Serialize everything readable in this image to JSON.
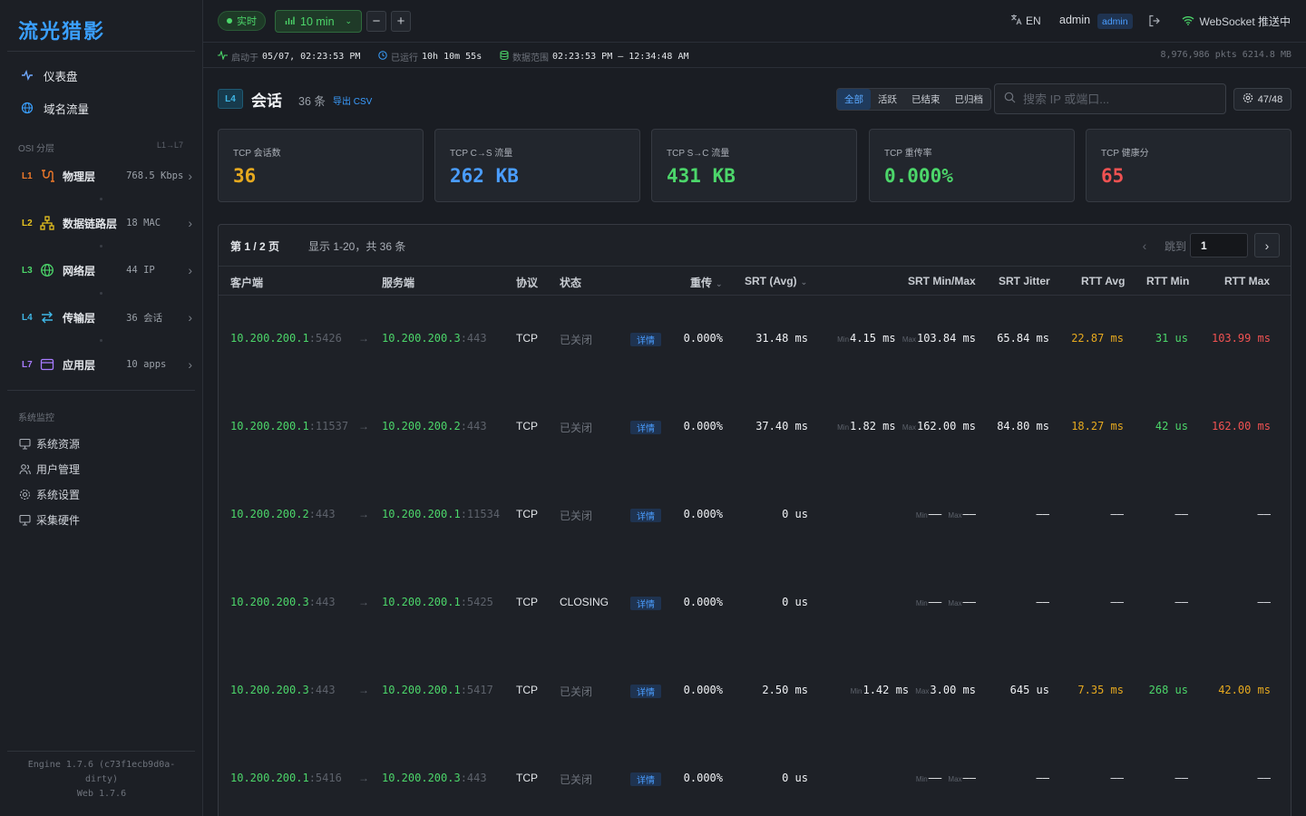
{
  "app": {
    "brand": "流光猎影",
    "nav": {
      "dashboard": "仪表盘",
      "dns": "域名流量"
    },
    "osi_title": "OSI 分层",
    "osi_range": "L1→L7",
    "layers": [
      {
        "code": "L1",
        "label": "物理层",
        "value": "768.5 Kbps",
        "color": "#f07a2a"
      },
      {
        "code": "L2",
        "label": "数据链路层",
        "value": "18 MAC",
        "color": "#e6c21f"
      },
      {
        "code": "L3",
        "label": "网络层",
        "value": "44 IP",
        "color": "#4cd66a"
      },
      {
        "code": "L4",
        "label": "传输层",
        "value": "36 会话",
        "color": "#3fb7e6"
      },
      {
        "code": "L7",
        "label": "应用层",
        "value": "10 apps",
        "color": "#a77bff"
      }
    ],
    "sys_title": "系统监控",
    "sys_items": [
      "系统资源",
      "用户管理",
      "系统设置",
      "采集硬件"
    ],
    "footer": {
      "engine": "Engine 1.7.6 (c73f1ecb9d0a-",
      "engine2": "dirty)",
      "web": "Web 1.7.6"
    }
  },
  "topbar": {
    "live": "实时",
    "range": "10 min",
    "minus": "−",
    "plus": "+",
    "lang": "EN",
    "user": "admin",
    "role": "admin",
    "ws": "WebSocket 推送中"
  },
  "info": {
    "start_k": "启动于",
    "start_v": "05/07, 02:23:53 PM",
    "uptime_k": "已运行",
    "uptime_v": "10h 10m 55s",
    "range_k": "数据范围",
    "range_v": "02:23:53 PM – 12:34:48 AM",
    "pkts": "8,976,986 pkts  6214.8 MB"
  },
  "section": {
    "badge": "L4",
    "title": "会话",
    "count": "36 条",
    "export": "导出 CSV",
    "filters": [
      "全部",
      "活跃",
      "已结束",
      "已归档"
    ],
    "search_placeholder": "搜索 IP 或端口...",
    "columns_btn": "47/48"
  },
  "kpis": [
    {
      "label": "TCP 会话数",
      "value": "36",
      "color": "#e6a91f"
    },
    {
      "label": "TCP C→S 流量",
      "value": "262 KB",
      "color": "#4a9dff"
    },
    {
      "label": "TCP S→C 流量",
      "value": "431 KB",
      "color": "#4cd66a"
    },
    {
      "label": "TCP 重传率",
      "value": "0.000%",
      "color": "#4cd66a"
    },
    {
      "label": "TCP 健康分",
      "value": "65",
      "color": "#f05252"
    }
  ],
  "table": {
    "page_label": "第 1 / 2 页",
    "summary": "显示 1-20，共 36 条",
    "jump_label": "跳到",
    "jump_value": "1",
    "headers": {
      "client": "客户端",
      "server": "服务端",
      "proto": "协议",
      "state": "状态",
      "retrans": "重传",
      "srt_avg": "SRT (Avg)",
      "srt_mm": "SRT Min/Max",
      "srt_jitter": "SRT Jitter",
      "rtt_avg": "RTT Avg",
      "rtt_min": "RTT Min",
      "rtt_max": "RTT Max"
    },
    "detail_label": "详情",
    "min_tag": "Min",
    "max_tag": "Max",
    "rows": [
      {
        "cip": "10.200.200.1",
        "cport": ":5426",
        "sip": "10.200.200.3",
        "sport": ":443",
        "proto": "TCP",
        "state": "已关闭",
        "retrans": "0.000%",
        "srt_avg": "31.48 ms",
        "srt_min": "4.15 ms",
        "srt_max": "103.84 ms",
        "jitter": "65.84 ms",
        "rtt_avg": "22.87 ms",
        "rtt_min": "31 us",
        "rtt_max": "103.99 ms"
      },
      {
        "cip": "10.200.200.1",
        "cport": ":11537",
        "sip": "10.200.200.2",
        "sport": ":443",
        "proto": "TCP",
        "state": "已关闭",
        "retrans": "0.000%",
        "srt_avg": "37.40 ms",
        "srt_min": "1.82 ms",
        "srt_max": "162.00 ms",
        "jitter": "84.80 ms",
        "rtt_avg": "18.27 ms",
        "rtt_min": "42 us",
        "rtt_max": "162.00 ms"
      },
      {
        "cip": "10.200.200.2",
        "cport": ":443",
        "sip": "10.200.200.1",
        "sport": ":11534",
        "proto": "TCP",
        "state": "已关闭",
        "retrans": "0.000%",
        "srt_avg": "0 us",
        "srt_min": "——",
        "srt_max": "——",
        "jitter": "——",
        "rtt_avg": "——",
        "rtt_min": "——",
        "rtt_max": "——"
      },
      {
        "cip": "10.200.200.3",
        "cport": ":443",
        "sip": "10.200.200.1",
        "sport": ":5425",
        "proto": "TCP",
        "state": "CLOSING",
        "retrans": "0.000%",
        "srt_avg": "0 us",
        "srt_min": "——",
        "srt_max": "——",
        "jitter": "——",
        "rtt_avg": "——",
        "rtt_min": "——",
        "rtt_max": "——"
      },
      {
        "cip": "10.200.200.3",
        "cport": ":443",
        "sip": "10.200.200.1",
        "sport": ":5417",
        "proto": "TCP",
        "state": "已关闭",
        "retrans": "0.000%",
        "srt_avg": "2.50 ms",
        "srt_min": "1.42 ms",
        "srt_max": "3.00 ms",
        "jitter": "645 us",
        "rtt_avg": "7.35 ms",
        "rtt_min": "268 us",
        "rtt_max": "42.00 ms"
      },
      {
        "cip": "10.200.200.1",
        "cport": ":5416",
        "sip": "10.200.200.3",
        "sport": ":443",
        "proto": "TCP",
        "state": "已关闭",
        "retrans": "0.000%",
        "srt_avg": "0 us",
        "srt_min": "——",
        "srt_max": "——",
        "jitter": "——",
        "rtt_avg": "——",
        "rtt_min": "——",
        "rtt_max": "——"
      }
    ]
  },
  "colors": {
    "accent": "#3aa0ff",
    "ok": "#4cd66a",
    "warn": "#e6a91f",
    "bad": "#f05252"
  }
}
